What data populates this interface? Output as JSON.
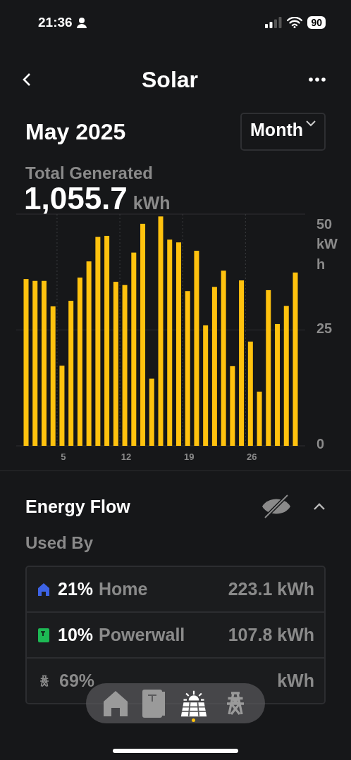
{
  "status_bar": {
    "time": "21:36",
    "battery": "90"
  },
  "nav": {
    "title": "Solar"
  },
  "period": {
    "label": "May 2025",
    "range": "Month"
  },
  "summary": {
    "label": "Total Generated",
    "value": "1,055.7",
    "unit": "kWh"
  },
  "chart": {
    "chart_data": {
      "type": "bar",
      "ylabel": "kWh",
      "x": [
        1,
        2,
        3,
        4,
        5,
        6,
        7,
        8,
        9,
        10,
        11,
        12,
        13,
        14,
        15,
        16,
        17,
        18,
        19,
        20,
        21,
        22,
        23,
        24,
        25,
        26,
        27,
        28,
        29,
        30,
        31
      ],
      "xticks": [
        5,
        12,
        19,
        26
      ],
      "yticks": [
        0,
        25,
        50
      ],
      "ylim": [
        0,
        50
      ],
      "xlim": [
        -0.1,
        32.1
      ],
      "series": [
        {
          "color": "#ffc20e",
          "values": [
            36.0,
            35.6,
            35.6,
            30.1,
            17.3,
            31.3,
            36.3,
            39.8,
            45.1,
            45.3,
            35.4,
            34.7,
            41.7,
            47.9,
            14.5,
            49.5,
            44.5,
            43.9,
            33.4,
            42.1,
            26.0,
            34.3,
            37.8,
            17.2,
            35.7,
            22.5,
            11.7,
            33.6,
            26.3,
            30.2,
            37.4
          ]
        }
      ]
    }
  },
  "energy_flow": {
    "title": "Energy Flow",
    "subtitle": "Used By",
    "expanded": true,
    "rows": [
      {
        "kind": "home",
        "color": "#3d63e6",
        "dimmed": false,
        "pct": "21%",
        "label": "Home",
        "value": "223.1 kWh"
      },
      {
        "kind": "powerwall",
        "color": "#1db954",
        "dimmed": false,
        "pct": "10%",
        "label": "Powerwall",
        "value": "107.8 kWh"
      },
      {
        "kind": "grid",
        "color": "#8a8a8a",
        "dimmed": true,
        "pct": "69%",
        "value": "kWh"
      }
    ]
  },
  "dock": [
    {
      "kind": "home",
      "selected": false
    },
    {
      "kind": "powerwall",
      "selected": false
    },
    {
      "kind": "solar",
      "selected": true
    },
    {
      "kind": "grid",
      "selected": false
    }
  ]
}
